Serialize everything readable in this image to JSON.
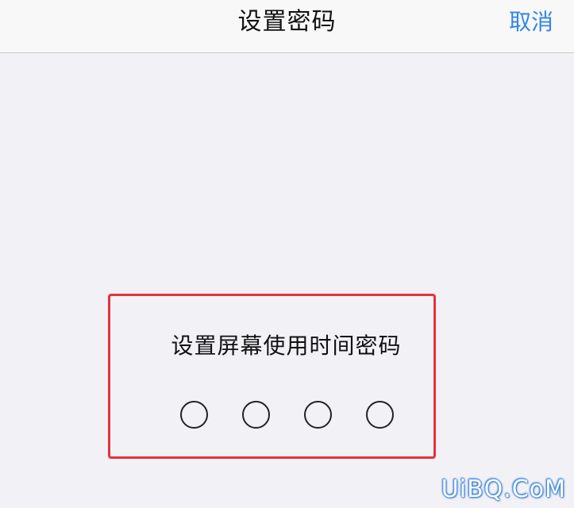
{
  "nav": {
    "title": "设置密码",
    "cancel_label": "取消"
  },
  "passcode": {
    "prompt": "设置屏幕使用时间密码",
    "digits_total": 4,
    "digits_entered": 0
  },
  "watermark": {
    "text": "UiBQ.CoM"
  },
  "colors": {
    "accent": "#2f86e7",
    "highlight_border": "#e5323b",
    "background": "#f2f1f6"
  }
}
